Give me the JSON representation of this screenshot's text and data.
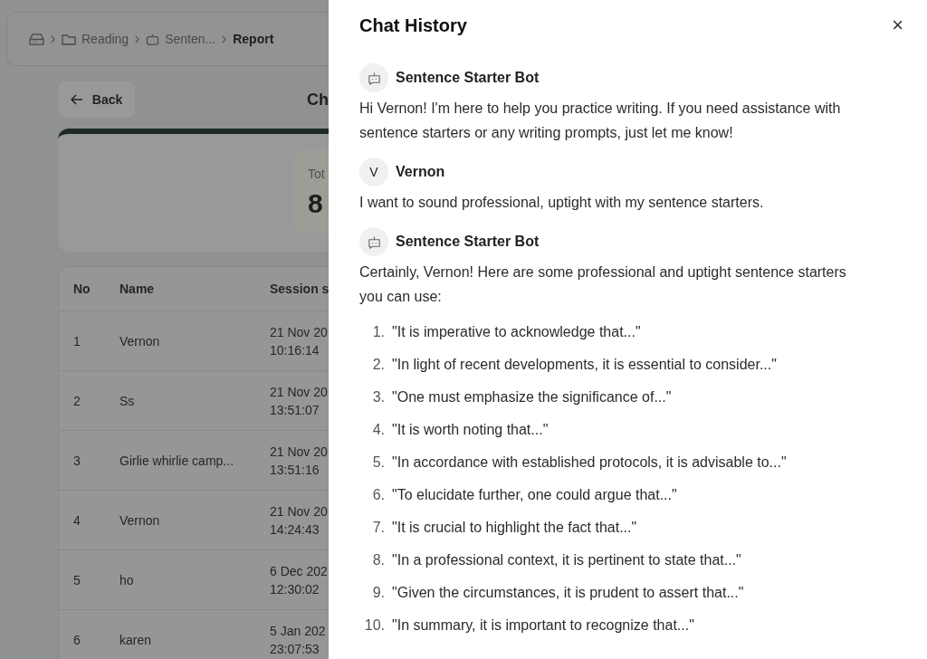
{
  "breadcrumb": [
    {
      "kind": "home"
    },
    {
      "kind": "folder",
      "label": "Reading"
    },
    {
      "kind": "bot",
      "label": "Senten..."
    },
    {
      "kind": "current",
      "label": "Report"
    }
  ],
  "back_button": "Back",
  "page_title": "Ch",
  "stat": {
    "label": "Tot",
    "value": "8"
  },
  "table": {
    "columns": [
      "No",
      "Name",
      "Session s"
    ],
    "rows": [
      {
        "no": "1",
        "name": "Vernon",
        "date": "21 Nov 20",
        "time": "10:16:14"
      },
      {
        "no": "2",
        "name": "Ss",
        "date": "21 Nov 20",
        "time": "13:51:07"
      },
      {
        "no": "3",
        "name": "Girlie whirlie camp...",
        "date": "21 Nov 20",
        "time": "13:51:16"
      },
      {
        "no": "4",
        "name": "Vernon",
        "date": "21 Nov 20",
        "time": "14:24:43"
      },
      {
        "no": "5",
        "name": "ho",
        "date": "6 Dec 202",
        "time": "12:30:02"
      },
      {
        "no": "6",
        "name": "karen",
        "date": "5 Jan 202",
        "time": "23:07:53"
      }
    ]
  },
  "drawer": {
    "title": "Chat History",
    "close": "×",
    "messages": [
      {
        "kind": "bot",
        "sender": "Sentence Starter Bot",
        "text": "Hi Vernon! I'm here to help you practice writing. If you need assistance with sentence starters or any writing prompts, just let me know!"
      },
      {
        "kind": "user",
        "avatar": "V",
        "sender": "Vernon",
        "text": "I want to sound professional, uptight with my sentence starters."
      },
      {
        "kind": "bot",
        "sender": "Sentence Starter Bot",
        "text": "Certainly, Vernon! Here are some professional and uptight sentence starters you can use:",
        "list": [
          {
            "number": "1.",
            "text": "\"It is imperative to acknowledge that...\""
          },
          {
            "number": "2.",
            "text": "\"In light of recent developments, it is essential to consider...\""
          },
          {
            "number": "3.",
            "text": "\"One must emphasize the significance of...\""
          },
          {
            "number": "4.",
            "text": "\"It is worth noting that...\""
          },
          {
            "number": "5.",
            "text": "\"In accordance with established protocols, it is advisable to...\""
          },
          {
            "number": "6.",
            "text": "\"To elucidate further, one could argue that...\""
          },
          {
            "number": "7.",
            "text": "\"It is crucial to highlight the fact that...\""
          },
          {
            "number": "8.",
            "text": "\"In a professional context, it is pertinent to state that...\""
          },
          {
            "number": "9.",
            "text": "\"Given the circumstances, it is prudent to assert that...\""
          },
          {
            "number": "10.",
            "text": "\"In summary, it is important to recognize that...\""
          }
        ]
      }
    ]
  }
}
